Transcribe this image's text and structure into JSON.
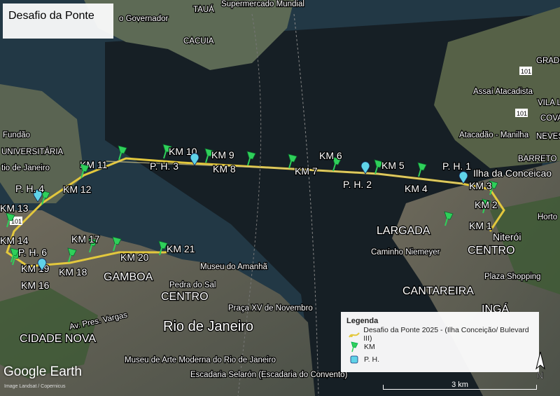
{
  "title": "Desafio da Ponte",
  "legend": {
    "heading": "Legenda",
    "items": [
      {
        "label": "Desafio da Ponte 2025 - (Ilha Conceição/ Bulevard III)",
        "icon": "route-icon",
        "color": "#e3c83d"
      },
      {
        "label": "KM",
        "icon": "green-pushpin-icon",
        "color": "#2fd05a"
      },
      {
        "label": "P. H.",
        "icon": "cyan-square-icon",
        "color": "#5fd3e8"
      }
    ]
  },
  "km_markers": [
    {
      "label": "KM 1"
    },
    {
      "label": "KM 2"
    },
    {
      "label": "KM 3"
    },
    {
      "label": "KM 4"
    },
    {
      "label": "KM 5"
    },
    {
      "label": "KM 6"
    },
    {
      "label": "KM 7"
    },
    {
      "label": "KM 8"
    },
    {
      "label": "KM 9"
    },
    {
      "label": "KM 10"
    },
    {
      "label": "KM 11"
    },
    {
      "label": "KM 12"
    },
    {
      "label": "KM 13"
    },
    {
      "label": "KM 14"
    },
    {
      "label": "KM 16"
    },
    {
      "label": "KM 17"
    },
    {
      "label": "KM 18"
    },
    {
      "label": "KM 19"
    },
    {
      "label": "KM 20"
    },
    {
      "label": "KM 21"
    }
  ],
  "ph_markers": [
    {
      "label": "P. H. 1"
    },
    {
      "label": "P. H. 2"
    },
    {
      "label": "P. H. 3"
    },
    {
      "label": "P. H. 4"
    },
    {
      "label": "P. H. 6"
    }
  ],
  "places": {
    "largada": "LARGADA",
    "rio": "Rio de Janeiro",
    "cidade_nova": "CIDADE NOVA",
    "gamboa": "GAMBOA",
    "centro_rio": "CENTRO",
    "centro_niteroi": "CENTRO",
    "niteroi": "Niterói",
    "cantareira": "CANTAREIRA",
    "inga": "INGÁ",
    "ilha": "Ilha da Conceicao",
    "barreto": "BARRETO",
    "museu_amanha": "Museu do Amanhã",
    "pedra_sal": "Pedra do Sal",
    "praca_xv": "Praça XV de Novembro",
    "mam": "Museu de Arte Moderna do Rio de Janeiro",
    "selaron": "Escadaria Selarón (Escadaria do Convento)",
    "caminho_niemeyer": "Caminho Niemeyer",
    "plaza": "Plaza Shopping",
    "atacadao": "Atacadão - Manilha",
    "assai": "Assaí Atacadista",
    "pres_vargas": "Av. Pres. Vargas",
    "fundao": "Fundão",
    "universitaria": "UNIVERSITÁRIA",
    "tio_janeiro": "tio de Janeiro",
    "hortolandia": "Horto",
    "cacuia": "CACUIA",
    "taua": "TAUÁ",
    "governador": "o Governador",
    "mundial": "Supermercado Mundial",
    "vila": "VILA L",
    "covanca": "COVA",
    "neves": "NEVES",
    "gradim": "GRADI",
    "rod_101": "101"
  },
  "scale": "3 km",
  "north": "N",
  "branding": "Google Earth",
  "credit": "Image Landsat / Copernicus"
}
